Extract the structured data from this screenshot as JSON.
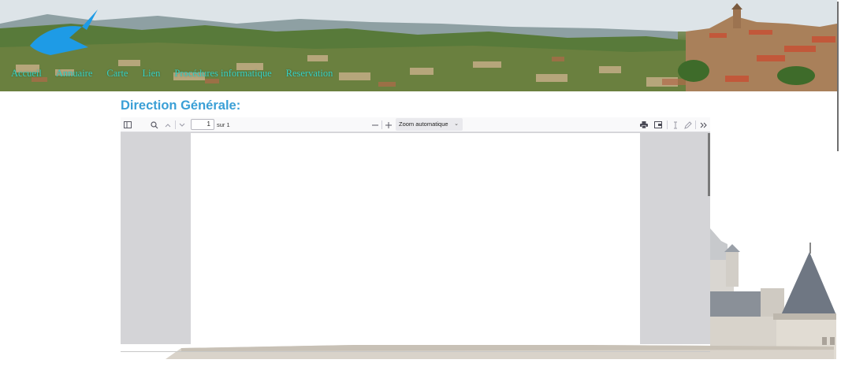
{
  "nav": {
    "items": [
      {
        "label": "Accueil"
      },
      {
        "label": "Annuaire"
      },
      {
        "label": "Carte"
      },
      {
        "label": "Lien"
      },
      {
        "label": "Procédures informatique"
      },
      {
        "label": "Reservation"
      }
    ]
  },
  "heading": "Direction Générale:",
  "pdf_viewer": {
    "page_number": "1",
    "page_of": "sur 1",
    "zoom": "Zoom automatique"
  },
  "colors": {
    "nav_link": "#36d1c4",
    "heading": "#3a9fd6",
    "logo": "#1e9be6"
  },
  "icons": [
    "sidebar-toggle-icon",
    "search-icon",
    "chevron-up-icon",
    "chevron-down-icon",
    "zoom-out-icon",
    "zoom-in-icon",
    "print-icon",
    "save-icon",
    "text-cursor-icon",
    "draw-icon",
    "more-tools-icon"
  ]
}
